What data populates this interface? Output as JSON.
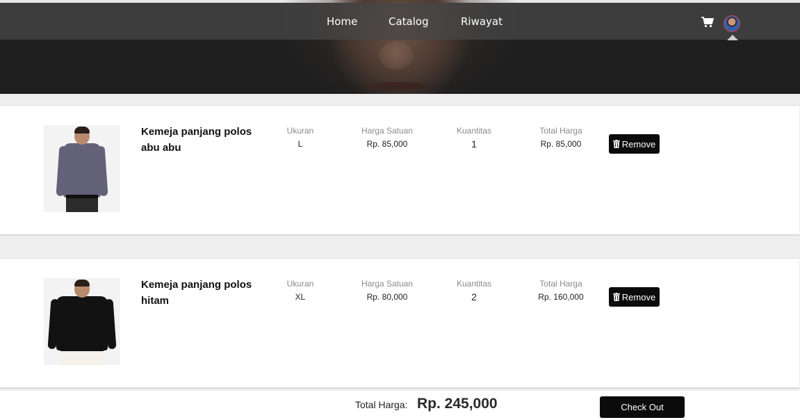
{
  "nav": {
    "home": "Home",
    "catalog": "Catalog",
    "riwayat": "Riwayat"
  },
  "header_icons": [
    "cart-icon",
    "avatar"
  ],
  "cart": {
    "items": [
      {
        "name": "Kemeja panjang polos abu abu",
        "size_label": "Ukuran",
        "size": "L",
        "unit_price_label": "Harga Satuan",
        "unit_price": "Rp. 85,000",
        "qty_label": "Kuantitas",
        "qty": "1",
        "total_label": "Total Harga",
        "total": "Rp. 85,000",
        "remove_label": "Remove",
        "shirt_color": "#646278"
      },
      {
        "name": "Kemeja panjang polos hitam",
        "size_label": "Ukuran",
        "size": "XL",
        "unit_price_label": "Harga Satuan",
        "unit_price": "Rp. 80,000",
        "qty_label": "Kuantitas",
        "qty": "2",
        "total_label": "Total Harga",
        "total": "Rp. 160,000",
        "remove_label": "Remove",
        "shirt_color": "#121212"
      }
    ]
  },
  "summary": {
    "total_label": "Total Harga:",
    "total_value": "Rp. 245,000",
    "checkout_label": "Check Out"
  },
  "colors": {
    "navbar": "#464646",
    "hero": "#1f1f1f",
    "button": "#0b0b0b",
    "page_bg": "#efeeef"
  }
}
